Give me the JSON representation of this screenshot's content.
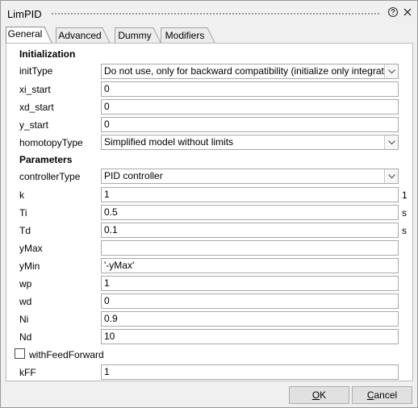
{
  "window": {
    "title": "LimPID"
  },
  "tabs": [
    {
      "label": "General",
      "active": true
    },
    {
      "label": "Advanced",
      "active": false
    },
    {
      "label": "Dummy",
      "active": false
    },
    {
      "label": "Modifiers",
      "active": false
    }
  ],
  "sections": {
    "initialization": "Initialization",
    "parameters": "Parameters"
  },
  "fields": {
    "initType": {
      "label": "initType",
      "value": "Do not use, only for backward compatibility (initialize only integrator state)"
    },
    "xi_start": {
      "label": "xi_start",
      "value": "0"
    },
    "xd_start": {
      "label": "xd_start",
      "value": "0"
    },
    "y_start": {
      "label": "y_start",
      "value": "0"
    },
    "homotopyType": {
      "label": "homotopyType",
      "value": "Simplified model without limits"
    },
    "controllerType": {
      "label": "controllerType",
      "value": "PID controller"
    },
    "k": {
      "label": "k",
      "value": "1",
      "unit": "1"
    },
    "Ti": {
      "label": "Ti",
      "value": "0.5",
      "unit": "s"
    },
    "Td": {
      "label": "Td",
      "value": "0.1",
      "unit": "s"
    },
    "yMax": {
      "label": "yMax",
      "value": ""
    },
    "yMin": {
      "label": "yMin",
      "value": "'-yMax'"
    },
    "wp": {
      "label": "wp",
      "value": "1"
    },
    "wd": {
      "label": "wd",
      "value": "0"
    },
    "Ni": {
      "label": "Ni",
      "value": "0.9"
    },
    "Nd": {
      "label": "Nd",
      "value": "10"
    },
    "withFeedForward": {
      "label": "withFeedForward",
      "checked": false
    },
    "kFF": {
      "label": "kFF",
      "value": "1"
    }
  },
  "buttons": {
    "ok": {
      "mnemonic": "O",
      "rest": "K"
    },
    "cancel": {
      "mnemonic": "C",
      "rest": "ancel"
    }
  },
  "colors": {
    "panel": "#ffffff",
    "background": "#f0f0f0",
    "border": "#a9a9a9"
  }
}
